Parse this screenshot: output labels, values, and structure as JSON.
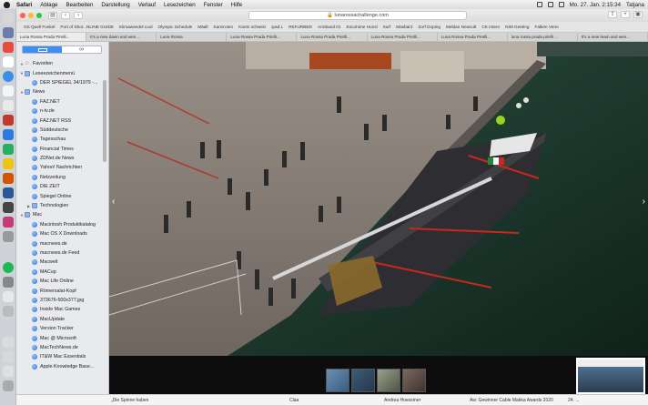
{
  "menubar": {
    "items": [
      "Safari",
      "Ablage",
      "Bearbeiten",
      "Darstellung",
      "Verlauf",
      "Lesezeichen",
      "Fenster",
      "Hilfe"
    ],
    "clock": "Mo. 27. Jan.  2:15:34",
    "user": "Tatjana"
  },
  "toolbar": {
    "url": "lunarossachallenge.com"
  },
  "favorites": [
    "OS Quell Funkel",
    "Port of Shor...NLINE GUIDE",
    "Klimawandel cool",
    "Olympic Schedule",
    "Mäall",
    "Karniroten",
    "Kantn schweiz",
    "ipad L",
    "REFURBED",
    "Armband 01",
    "Encohime Hunsl",
    "Surf",
    "Masbar2",
    "Zorf Doping",
    "Meldan Newcult",
    "CK Intern",
    "NIM Geeting",
    "Falken Verei"
  ],
  "tabs": [
    "Luna Rossa Prada Pirelli...",
    "It's a new dawn and wen...",
    "Luna Rossa",
    "Luna Rossa Prada Pirelli...",
    "Luna Rossa Prada Pirelli...",
    "Luna Rossa Prada Pirelli...",
    "Luna Rossa Prada Pirelli...",
    "luna rossa prada pirelli ...",
    "It's a new team and wen..."
  ],
  "sidebar": {
    "rows": [
      {
        "label": "Favoriten",
        "icon": "star-icon",
        "level": 0,
        "folder": true
      },
      {
        "label": "Leseezeichenmenü",
        "icon": "folder-icon",
        "level": 0,
        "folder": true
      },
      {
        "label": "DER SPIEGEL 34/1979 -...",
        "icon": "globe-icon",
        "level": 1
      },
      {
        "label": "News",
        "icon": "folder-icon",
        "level": 0,
        "folder": true
      },
      {
        "label": "FAZ.NET",
        "icon": "globe-icon",
        "level": 2
      },
      {
        "label": "n-tv.de",
        "icon": "globe-icon",
        "level": 2
      },
      {
        "label": "FAZ.NET RSS",
        "icon": "globe-icon",
        "level": 2
      },
      {
        "label": "Süddeutsche",
        "icon": "globe-icon",
        "level": 2
      },
      {
        "label": "Tagesschau",
        "icon": "globe-icon",
        "level": 2
      },
      {
        "label": "Financial Times",
        "icon": "globe-icon",
        "level": 2
      },
      {
        "label": "ZDNet.de News",
        "icon": "globe-icon",
        "level": 2
      },
      {
        "label": "Yahoo! Nachrichten",
        "icon": "globe-icon",
        "level": 2
      },
      {
        "label": "Netzzeitung",
        "icon": "globe-icon",
        "level": 2
      },
      {
        "label": "DIE ZEIT",
        "icon": "globe-icon",
        "level": 2
      },
      {
        "label": "Spiegel Online",
        "icon": "globe-icon",
        "level": 2
      },
      {
        "label": "Technologien",
        "icon": "folder-icon",
        "level": 1,
        "folder": true
      },
      {
        "label": "Mac",
        "icon": "folder-icon",
        "level": 0,
        "folder": true
      },
      {
        "label": "Macintosh Produktkatalog",
        "icon": "globe-icon",
        "level": 2
      },
      {
        "label": "Mac OS X Downloads",
        "icon": "globe-icon",
        "level": 2
      },
      {
        "label": "macnews.de",
        "icon": "globe-icon",
        "level": 2
      },
      {
        "label": "macnews.de Feed",
        "icon": "globe-icon",
        "level": 2
      },
      {
        "label": "Macwelt",
        "icon": "globe-icon",
        "level": 2
      },
      {
        "label": "MACup",
        "icon": "globe-icon",
        "level": 2
      },
      {
        "label": "Mac Life Online",
        "icon": "globe-icon",
        "level": 2
      },
      {
        "label": "Römersalat-Kopf",
        "icon": "globe-icon",
        "level": 2
      },
      {
        "label": "373676-500x377.jpg",
        "icon": "globe-icon",
        "level": 2
      },
      {
        "label": "Inside Mac Games",
        "icon": "globe-icon",
        "level": 2
      },
      {
        "label": "MacUpdate",
        "icon": "globe-icon",
        "level": 2
      },
      {
        "label": "Version Tracker",
        "icon": "globe-icon",
        "level": 2
      },
      {
        "label": "Mac @ Microsoft",
        "icon": "globe-icon",
        "level": 2
      },
      {
        "label": "MacTechNews.de",
        "icon": "globe-icon",
        "level": 2
      },
      {
        "label": "IT&W Mac Essentials",
        "icon": "globe-icon",
        "level": 2
      },
      {
        "label": "Apple Knowledge Base...",
        "icon": "globe-icon",
        "level": 2
      }
    ]
  },
  "bottom": {
    "left": "„Die Spinne haben",
    "mid": "Claa",
    "author": "Andrea Hoessmer",
    "award": "Aw: Gewinner Cable Makka Awards 2020",
    "date": "24. ..."
  },
  "colors": {
    "accent": "#3d8ff5",
    "sail_stripe": "#c8281e"
  }
}
